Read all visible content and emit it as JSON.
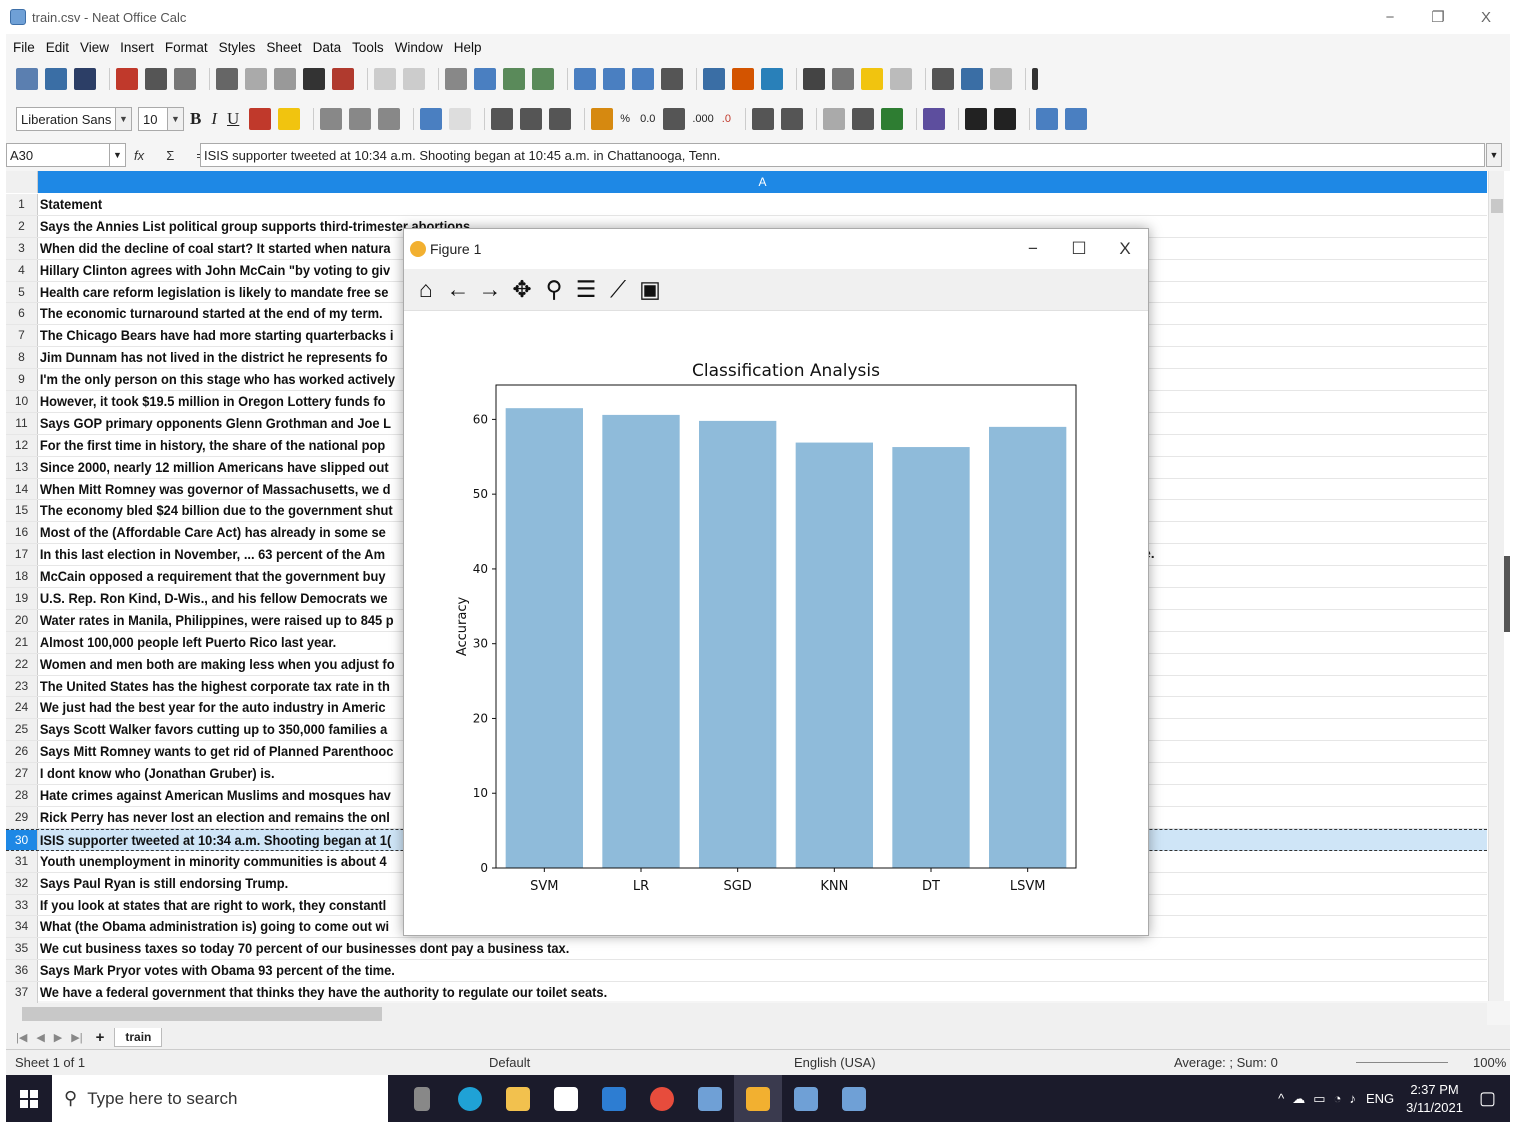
{
  "window": {
    "title": "train.csv - Neat Office Calc",
    "minimize": "−",
    "restore": "❐",
    "close": "X"
  },
  "menu": [
    "File",
    "Edit",
    "View",
    "Insert",
    "Format",
    "Styles",
    "Sheet",
    "Data",
    "Tools",
    "Window",
    "Help"
  ],
  "format_toolbar": {
    "font_name": "Liberation Sans",
    "font_size": "10",
    "bold": "B",
    "italic": "I",
    "underline": "U",
    "percent": "%",
    "decimal": "0.0",
    "add_decimal": ".000",
    "del_decimal": ".0"
  },
  "formula_bar": {
    "cell_ref": "A30",
    "fx": "fx",
    "sigma": "Σ",
    "equals": "=",
    "content": "ISIS supporter tweeted at 10:34 a.m. Shooting began at 10:45 a.m. in Chattanooga, Tenn."
  },
  "grid": {
    "column_a": "A",
    "selected_row": 30,
    "row17_overflow": "e.",
    "rows": [
      {
        "n": "1",
        "text": "Statement"
      },
      {
        "n": "2",
        "text": "Says the Annies List political group supports third-trimester abortions"
      },
      {
        "n": "3",
        "text": "When did the decline of coal start? It started when natura"
      },
      {
        "n": "4",
        "text": "Hillary Clinton agrees with John McCain \"by voting to giv"
      },
      {
        "n": "5",
        "text": "Health care reform legislation is likely to mandate free se"
      },
      {
        "n": "6",
        "text": "The economic turnaround started at the end of my term."
      },
      {
        "n": "7",
        "text": "The Chicago Bears have had more starting quarterbacks i"
      },
      {
        "n": "8",
        "text": "Jim Dunnam has not lived in the district he represents fo"
      },
      {
        "n": "9",
        "text": "I'm the only person on this stage who has worked actively"
      },
      {
        "n": "10",
        "text": "However, it took $19.5 million in Oregon Lottery funds fo"
      },
      {
        "n": "11",
        "text": "Says GOP primary opponents Glenn Grothman and Joe L"
      },
      {
        "n": "12",
        "text": "For the first time in history, the share of the national pop"
      },
      {
        "n": "13",
        "text": "Since 2000, nearly 12 million Americans have slipped out"
      },
      {
        "n": "14",
        "text": "When Mitt Romney was governor of Massachusetts, we d"
      },
      {
        "n": "15",
        "text": "The economy bled $24 billion due to the government shut"
      },
      {
        "n": "16",
        "text": "Most of the (Affordable Care Act) has already in some se"
      },
      {
        "n": "17",
        "text": "In this last election in November, ... 63 percent of the Am"
      },
      {
        "n": "18",
        "text": "McCain opposed a requirement that the government buy"
      },
      {
        "n": "19",
        "text": "U.S. Rep. Ron Kind, D-Wis., and his fellow Democrats we"
      },
      {
        "n": "20",
        "text": "Water rates in Manila, Philippines, were raised up to 845 p"
      },
      {
        "n": "21",
        "text": "Almost 100,000 people left Puerto Rico last year."
      },
      {
        "n": "22",
        "text": "Women and men both are making less when you adjust fo"
      },
      {
        "n": "23",
        "text": "The United States has the highest corporate tax rate in th"
      },
      {
        "n": "24",
        "text": "We just had the best year for the auto industry in Americ"
      },
      {
        "n": "25",
        "text": "Says Scott Walker favors cutting up to 350,000 families a"
      },
      {
        "n": "26",
        "text": "Says Mitt Romney wants to get rid of Planned Parenthooc"
      },
      {
        "n": "27",
        "text": "I dont know who (Jonathan Gruber) is."
      },
      {
        "n": "28",
        "text": "Hate crimes against American Muslims and mosques hav"
      },
      {
        "n": "29",
        "text": "Rick Perry has never lost an election and remains the onl"
      },
      {
        "n": "30",
        "text": "ISIS supporter tweeted at 10:34 a.m. Shooting began at 1("
      },
      {
        "n": "31",
        "text": "Youth unemployment in minority communities is about 4"
      },
      {
        "n": "32",
        "text": "Says Paul Ryan is still endorsing Trump."
      },
      {
        "n": "33",
        "text": "If you look at states that are right to work, they constantl"
      },
      {
        "n": "34",
        "text": "What (the Obama administration is) going to come out wi"
      },
      {
        "n": "35",
        "text": "We cut business taxes so today 70 percent of our businesses dont pay a business tax."
      },
      {
        "n": "36",
        "text": "Says Mark Pryor votes with Obama 93 percent of the time."
      },
      {
        "n": "37",
        "text": "We have a federal government that thinks they have the authority to regulate our toilet seats."
      }
    ]
  },
  "sheet_tabs": {
    "active": "train",
    "add": "+"
  },
  "status_bar": {
    "sheet": "Sheet 1 of 1",
    "style": "Default",
    "language": "English (USA)",
    "stats": "Average: ; Sum: 0",
    "zoom": "100%"
  },
  "figure": {
    "title": "Figure 1",
    "minimize": "−",
    "maximize": "☐",
    "close": "X"
  },
  "chart_data": {
    "type": "bar",
    "title": "Classification Analysis",
    "xlabel": "",
    "ylabel": "Accuracy",
    "categories": [
      "SVM",
      "LR",
      "SGD",
      "KNN",
      "DT",
      "LSVM"
    ],
    "values": [
      61.5,
      60.6,
      59.8,
      56.9,
      56.3,
      59.0
    ],
    "ylim": [
      0,
      64.6
    ],
    "yticks": [
      0,
      10,
      20,
      30,
      40,
      50,
      60
    ],
    "bar_color": "#8fbbda",
    "grid": false
  },
  "taskbar": {
    "search_placeholder": "Type here to search",
    "language": "ENG",
    "time": "2:37 PM",
    "date": "3/11/2021"
  }
}
